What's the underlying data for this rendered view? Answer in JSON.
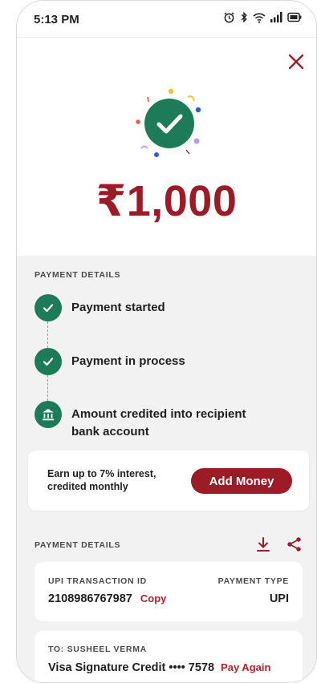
{
  "status_bar": {
    "time": "5:13 PM",
    "icons": [
      "alarm-icon",
      "bluetooth-icon",
      "wifi-icon",
      "signal-icon",
      "battery-icon"
    ]
  },
  "payment": {
    "amount": "₹1,000"
  },
  "timeline": {
    "label": "PAYMENT DETAILS",
    "steps": [
      {
        "text": "Payment started",
        "icon": "check-icon"
      },
      {
        "text": "Payment in process",
        "icon": "check-icon"
      },
      {
        "text": "Amount credited into recipient bank account",
        "icon": "bank-icon"
      }
    ]
  },
  "promo": {
    "text": "Earn up to 7% interest, credited monthly",
    "button": "Add Money"
  },
  "details": {
    "label": "PAYMENT DETAILS",
    "upi_label": "UPI TRANSACTION ID",
    "upi_id": "2108986767987",
    "copy": "Copy",
    "type_label": "PAYMENT TYPE",
    "type_value": "UPI",
    "to_label": "TO: SUSHEEL VERMA",
    "card_text": "Visa Signature Credit •••• 7578",
    "pay_again": "Pay Again"
  },
  "colors": {
    "brand_red": "#9b1c26",
    "success_green": "#1e7b59",
    "background_grey": "#f2f2f2"
  }
}
